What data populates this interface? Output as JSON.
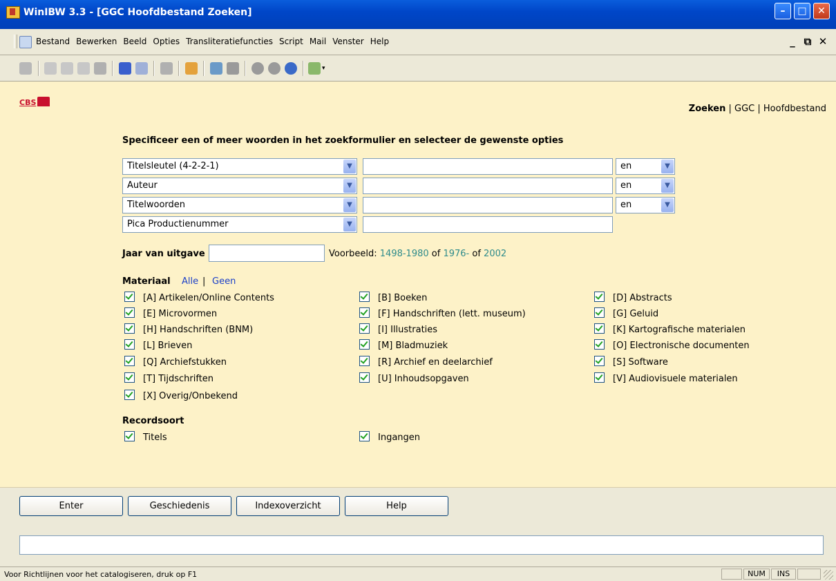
{
  "window": {
    "title": "WinIBW 3.3 - [GGC Hoofdbestand Zoeken]"
  },
  "menu": [
    "Bestand",
    "Bewerken",
    "Beeld",
    "Opties",
    "Transliteratiefuncties",
    "Script",
    "Mail",
    "Venster",
    "Help"
  ],
  "logo": {
    "text": "CBS"
  },
  "breadcrumb": {
    "current": "Zoeken",
    "sep": "|",
    "db": "GGC",
    "file": "Hoofdbestand"
  },
  "instruction": "Specificeer een of meer woorden in het zoekformulier en selecteer de gewenste opties",
  "search_rows": [
    {
      "field": "Titelsleutel (4-2-2-1)",
      "operator": "en"
    },
    {
      "field": "Auteur",
      "operator": "en"
    },
    {
      "field": "Titelwoorden",
      "operator": "en"
    },
    {
      "field": "Pica Productienummer",
      "operator": ""
    }
  ],
  "year": {
    "label": "Jaar van uitgave",
    "example_prefix": "Voorbeeld:",
    "ex1": "1498-1980",
    "of1": "of",
    "ex2": "1976-",
    "of2": "of",
    "ex3": "2002"
  },
  "material": {
    "label": "Materiaal",
    "all": "Alle",
    "sep": "|",
    "none": "Geen",
    "items": [
      "[A] Artikelen/Online Contents",
      "[B] Boeken",
      "[D] Abstracts",
      "[E] Microvormen",
      "[F] Handschriften (lett. museum)",
      "[G] Geluid",
      "[H] Handschriften (BNM)",
      "[I] Illustraties",
      "[K] Kartografische materialen",
      "[L] Brieven",
      "[M] Bladmuziek",
      "[O] Electronische documenten",
      "[Q] Archiefstukken",
      "[R] Archief en deelarchief",
      "[S] Software",
      "[T] Tijdschriften",
      "[U] Inhoudsopgaven",
      "[V] Audiovisuele materialen",
      "[X] Overig/Onbekend"
    ]
  },
  "recordsoort": {
    "label": "Recordsoort",
    "items": [
      "Titels",
      "Ingangen"
    ]
  },
  "buttons": {
    "enter": "Enter",
    "history": "Geschiedenis",
    "index": "Indexoverzicht",
    "help": "Help"
  },
  "status": {
    "message": "Voor Richtlijnen voor het catalogiseren, druk op F1",
    "num": "NUM",
    "ins": "INS"
  }
}
